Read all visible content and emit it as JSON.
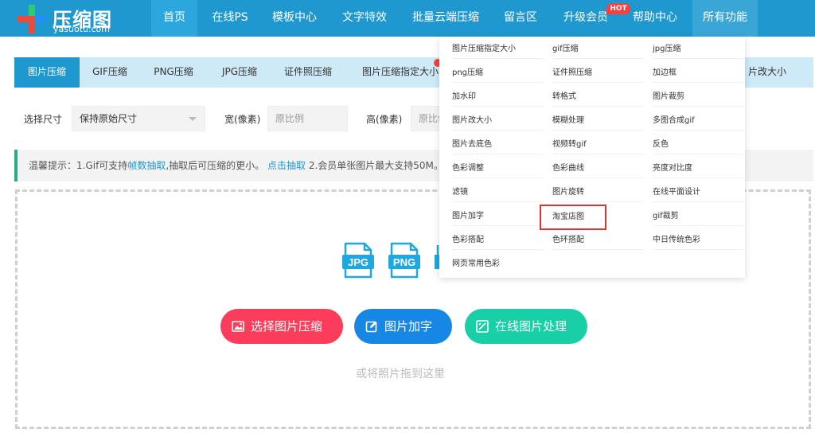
{
  "logo": {
    "cn": "压缩图",
    "en": "yasuotu.com"
  },
  "nav": [
    {
      "label": "首页"
    },
    {
      "label": "在线PS"
    },
    {
      "label": "模板中心"
    },
    {
      "label": "文字特效"
    },
    {
      "label": "批量云端压缩"
    },
    {
      "label": "留言区"
    },
    {
      "label": "升级会员"
    },
    {
      "label": "帮助中心"
    },
    {
      "label": "所有功能"
    }
  ],
  "hot_badge": "HOT",
  "tabs": [
    {
      "label": "图片压缩"
    },
    {
      "label": "GIF压缩"
    },
    {
      "label": "PNG压缩"
    },
    {
      "label": "JPG压缩"
    },
    {
      "label": "证件照压缩"
    },
    {
      "label": "图片压缩指定大小"
    },
    {
      "label": "片改大小"
    }
  ],
  "options": {
    "size_label": "选择尺寸",
    "size_value": "保持原始尺寸",
    "width_label": "宽(像素)",
    "width_placeholder": "原比例",
    "height_label": "高(像素)",
    "height_placeholder": "原比例"
  },
  "tip": {
    "prefix": "温馨提示：1.Gif可支持",
    "link1": "帧数抽取",
    "middle": ",抽取后可压缩的更小。",
    "link2": "点击抽取",
    "suffix": " 2.会员单张图片最大支持50M。"
  },
  "file_icons": [
    "JPG",
    "PNG"
  ],
  "buttons": {
    "select": "选择图片压缩",
    "add_text": "图片加字",
    "online": "在线图片处理"
  },
  "drop_hint": "或将照片拖到这里",
  "menu": {
    "columns": [
      [
        "图片压缩指定大小",
        "png压缩",
        "加水印",
        "图片改大小",
        "图片去底色",
        "色彩调整",
        "滤镜",
        "图片加字",
        "色彩搭配",
        "网页常用色彩"
      ],
      [
        "gif压缩",
        "证件照压缩",
        "转格式",
        "模糊处理",
        "视频转gif",
        "色彩曲线",
        "图片旋转",
        "淘宝店图",
        "色环搭配"
      ],
      [
        "jpg压缩",
        "加边框",
        "图片裁剪",
        "多图合成gif",
        "反色",
        "亮度对比度",
        "在线平面设计",
        "gif裁剪",
        "中日传统色彩"
      ]
    ],
    "highlighted": "淘宝店图"
  },
  "colors": {
    "nav_bg": "#1e98cf",
    "tab_bg": "#cdeaf6",
    "red_btn": "#fb3c5b",
    "blue_btn": "#1787e6",
    "green_btn": "#19cfa5",
    "highlight": "#e03030"
  }
}
